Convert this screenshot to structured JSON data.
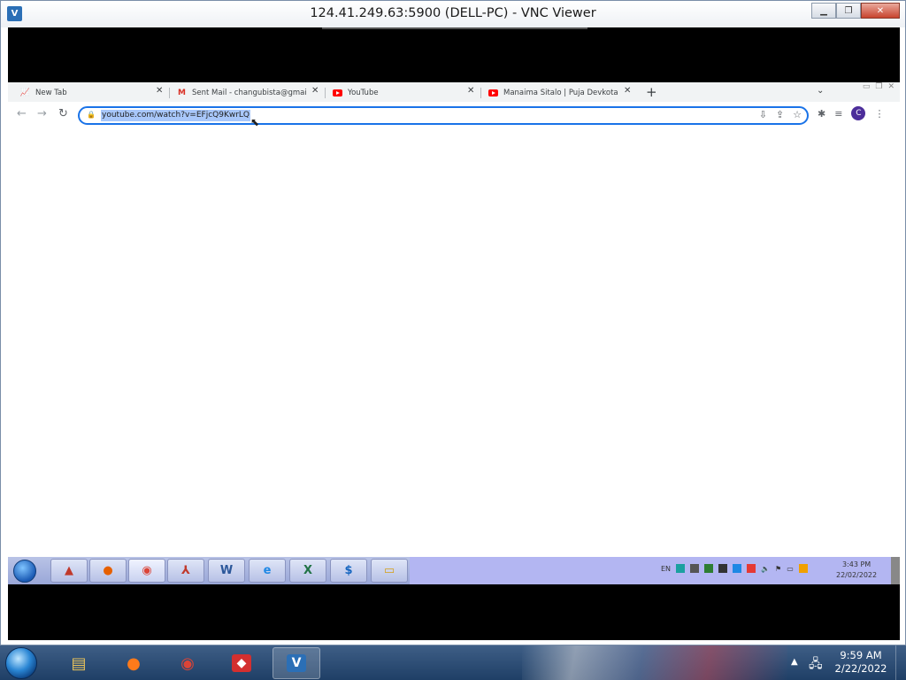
{
  "vnc_window": {
    "title": "124.41.249.63:5900 (DELL-PC) - VNC Viewer",
    "icon": "vnc-viewer-icon",
    "minimize_label": "▭",
    "maximize_label": "◻",
    "close_label": "✕"
  },
  "browser": {
    "tabs": [
      {
        "title": "New Tab",
        "icon": "new-tab-favicon"
      },
      {
        "title": "Sent Mail - changubista@gmail.c",
        "icon": "gmail-favicon"
      },
      {
        "title": "YouTube",
        "icon": "youtube-favicon"
      },
      {
        "title": "Manaima Sitalo | Puja Devkota |",
        "icon": "youtube-favicon"
      }
    ],
    "address_bar": {
      "url": "youtube.com/watch?v=EFjcQ9KwrLQ"
    },
    "profile_initial": "C"
  },
  "remote_taskbar": {
    "language": "EN",
    "time": "3:43 PM",
    "date": "22/02/2022"
  },
  "local_taskbar": {
    "time": "9:59 AM",
    "date": "2/22/2022"
  },
  "colors": {
    "accent_blue": "#1a73e8",
    "url_selection": "#a8c7fa",
    "youtube_red": "#ff0000"
  }
}
